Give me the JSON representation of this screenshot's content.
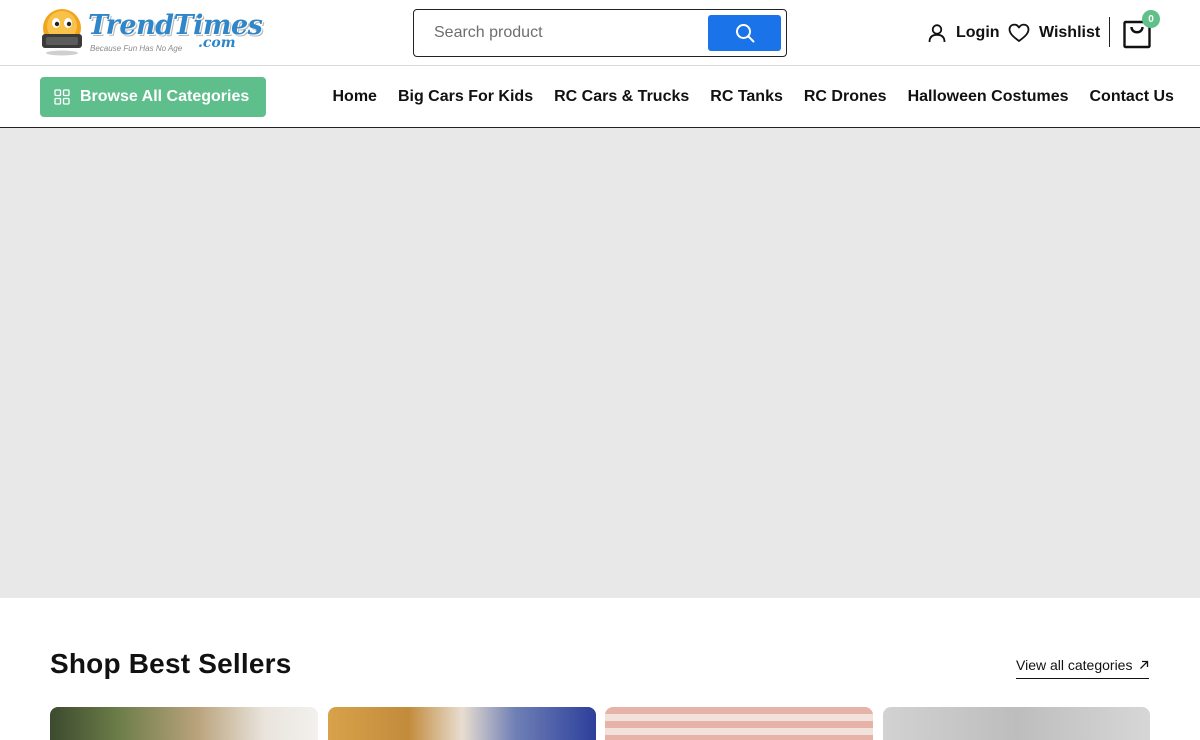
{
  "header": {
    "logo": {
      "name": "TrendTimes",
      "domain_suffix": ".com",
      "tagline": "Because Fun Has No Age"
    },
    "search": {
      "placeholder": "Search product",
      "button_icon": "search-icon"
    },
    "login_label": "Login",
    "wishlist_label": "Wishlist",
    "cart_count": "0",
    "icons": {
      "login": "user-icon",
      "wishlist": "heart-icon",
      "cart": "shopping-bag-icon"
    }
  },
  "nav": {
    "browse_label": "Browse All Categories",
    "browse_icon": "grid-icon",
    "items": [
      {
        "label": "Home"
      },
      {
        "label": "Big Cars For Kids"
      },
      {
        "label": "RC Cars & Trucks"
      },
      {
        "label": "RC Tanks"
      },
      {
        "label": "RC Drones"
      },
      {
        "label": "Halloween Costumes"
      },
      {
        "label": "Contact Us"
      }
    ]
  },
  "best_sellers": {
    "title": "Shop Best Sellers",
    "view_all_label": "View all categories",
    "view_all_icon": "arrow-up-right-icon"
  },
  "colors": {
    "brand_green": "#5fbf8c",
    "search_blue": "#1a73e8",
    "hero_placeholder": "#e8e8e8",
    "text": "#111111"
  }
}
